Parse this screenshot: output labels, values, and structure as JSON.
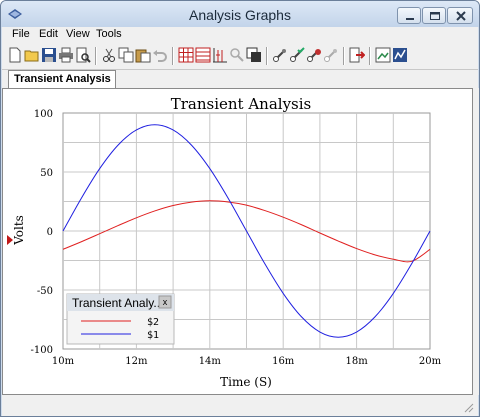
{
  "window": {
    "title": "Analysis Graphs"
  },
  "menu": [
    "File",
    "Edit",
    "View",
    "Tools"
  ],
  "toolbar": {
    "buttons": [
      "new-icon",
      "open-icon",
      "save-icon",
      "print-icon",
      "print-preview-icon",
      "cut-icon",
      "copy-icon",
      "paste-icon",
      "undo-icon",
      "grid-icon",
      "table-icon",
      "cursor-icon",
      "zoom-icon",
      "window-icon",
      "tool1-icon",
      "tool2-icon",
      "tool3-icon",
      "tool4-icon",
      "export-icon",
      "image-icon",
      "chart-icon"
    ]
  },
  "tabs": [
    {
      "label": "Transient Analysis",
      "active": true
    }
  ],
  "legend": {
    "title": "Transient Analy...",
    "close": "x"
  },
  "colors": {
    "s2": "#e02020",
    "s1": "#2020e0",
    "grid": "#c8c8c8",
    "marker": "#c01818"
  },
  "chart_data": {
    "type": "line",
    "title": "Transient Analysis",
    "xlabel": "Time (S)",
    "ylabel": "Volts",
    "xlim": [
      0.01,
      0.02
    ],
    "ylim": [
      -100,
      100
    ],
    "xticks": [
      0.01,
      0.012,
      0.014,
      0.016,
      0.018,
      0.02
    ],
    "xtick_labels": [
      "10m",
      "12m",
      "14m",
      "16m",
      "18m",
      "20m"
    ],
    "yticks": [
      100,
      50,
      0,
      -50,
      -100
    ],
    "ytick_labels": [
      "100",
      "50",
      "0",
      "-50",
      "-100"
    ],
    "grid": true,
    "legend_position": "bottom-left",
    "series": [
      {
        "name": "$2",
        "color": "#e02020",
        "x": [
          0.01,
          0.0105,
          0.011,
          0.0115,
          0.012,
          0.0125,
          0.013,
          0.0135,
          0.014,
          0.0145,
          0.015,
          0.0155,
          0.016,
          0.0165,
          0.017,
          0.0175,
          0.018,
          0.0185,
          0.019,
          0.0195,
          0.02
        ],
        "y": [
          -15.5,
          -9.1,
          -2.3,
          4.6,
          11.2,
          17.0,
          21.6,
          24.5,
          25.6,
          24.6,
          21.9,
          17.3,
          11.7,
          5.3,
          -1.7,
          -8.5,
          -14.9,
          -20.2,
          -23.9,
          -25.7,
          -15.5
        ]
      },
      {
        "name": "$1",
        "color": "#2020e0",
        "x": [
          0.01,
          0.0105,
          0.011,
          0.0115,
          0.012,
          0.0125,
          0.013,
          0.0135,
          0.014,
          0.0145,
          0.015,
          0.0155,
          0.016,
          0.0165,
          0.017,
          0.0175,
          0.018,
          0.0185,
          0.019,
          0.0195,
          0.02
        ],
        "y": [
          0,
          27.8,
          52.9,
          72.8,
          85.6,
          90.0,
          85.6,
          72.8,
          52.9,
          27.8,
          0,
          -27.8,
          -52.9,
          -72.8,
          -85.6,
          -90.0,
          -85.6,
          -72.8,
          -52.9,
          -27.8,
          0
        ]
      }
    ]
  }
}
